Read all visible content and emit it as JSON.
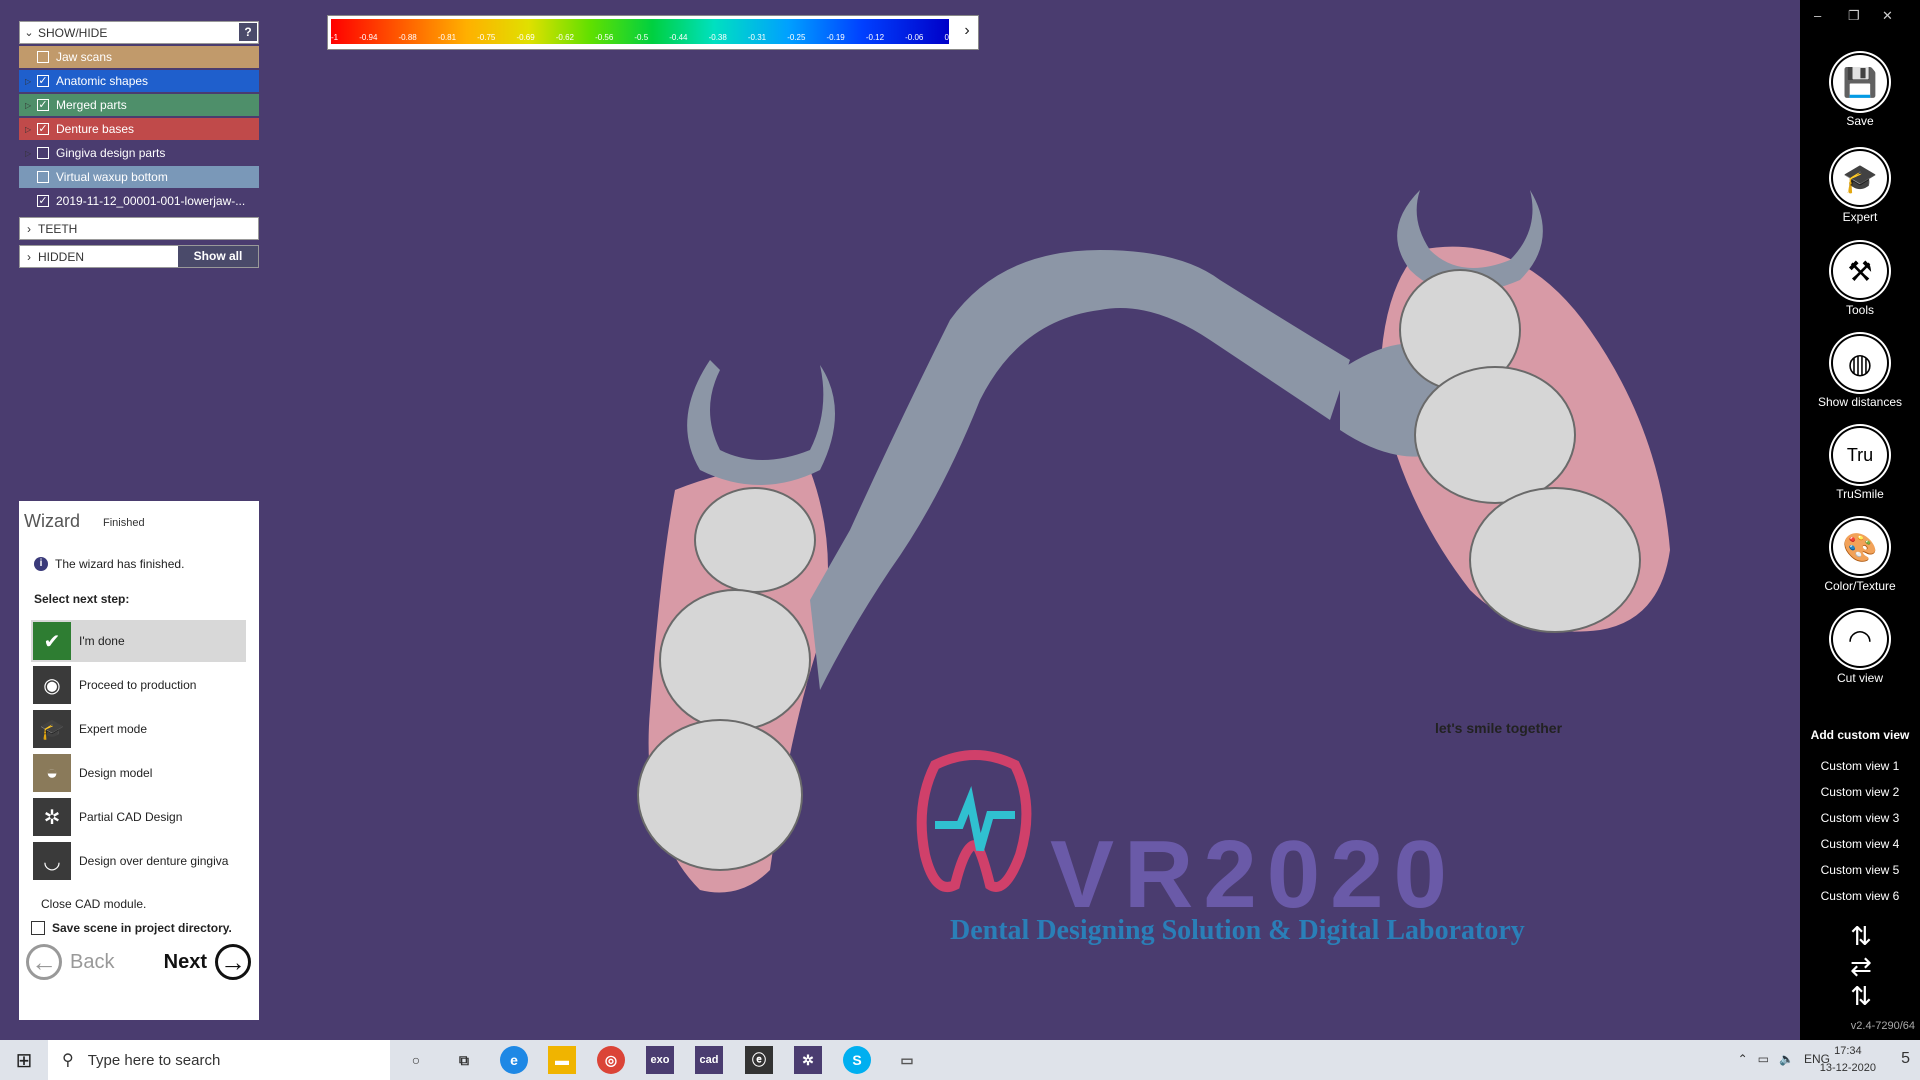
{
  "show_hide": {
    "title": "SHOW/HIDE",
    "help": "?",
    "layers": [
      {
        "label": "Jaw scans",
        "checked": false,
        "color": "#c19a6b"
      },
      {
        "label": "Anatomic shapes",
        "checked": true,
        "color": "#1f5fcc"
      },
      {
        "label": "Merged parts",
        "checked": true,
        "color": "#4e8f6a"
      },
      {
        "label": "Denture bases",
        "checked": true,
        "color": "#c04a4a"
      },
      {
        "label": "Gingiva design parts",
        "checked": false,
        "color": "#4a3c6f"
      },
      {
        "label": "Virtual waxup bottom",
        "checked": false,
        "color": "#7a98b8"
      },
      {
        "label": "2019-11-12_00001-001-lowerjaw-...",
        "checked": true,
        "color": "#4a3c6f"
      }
    ],
    "teeth": "TEETH",
    "hidden": "HIDDEN",
    "show_all": "Show all"
  },
  "color_scale": {
    "labels": [
      "-1",
      "-0.94",
      "-0.88",
      "-0.81",
      "-0.75",
      "-0.69",
      "-0.62",
      "-0.56",
      "-0.5",
      "-0.44",
      "-0.38",
      "-0.31",
      "-0.25",
      "-0.19",
      "-0.12",
      "-0.06",
      "0"
    ],
    "arrow": "›"
  },
  "wizard": {
    "title": "Wizard",
    "status": "Finished",
    "info": "The wizard has finished.",
    "select_label": "Select next step:",
    "steps": [
      {
        "label": "I'm done",
        "icon": "check-icon"
      },
      {
        "label": "Proceed to production",
        "icon": "mill-icon"
      },
      {
        "label": "Expert mode",
        "icon": "graduation-cap-icon"
      },
      {
        "label": "Design model",
        "icon": "model-icon"
      },
      {
        "label": "Partial CAD Design",
        "icon": "partial-icon"
      },
      {
        "label": "Design over denture gingiva",
        "icon": "gingiva-icon"
      }
    ],
    "close_cad": "Close CAD module.",
    "save_scene": "Save scene in project directory.",
    "back": "Back",
    "next": "Next"
  },
  "right_panel": {
    "tools": [
      {
        "label": "Save",
        "icon": "save-icon"
      },
      {
        "label": "Expert",
        "icon": "graduation-cap-icon"
      },
      {
        "label": "Tools",
        "icon": "tools-icon"
      },
      {
        "label": "Show distances",
        "icon": "distances-icon"
      },
      {
        "label": "TruSmile",
        "icon": "trusmile-icon"
      },
      {
        "label": "Color/Texture",
        "icon": "palette-icon"
      },
      {
        "label": "Cut view",
        "icon": "cut-view-icon"
      }
    ],
    "add_custom_view": "Add custom view",
    "custom_views": [
      "Custom view 1",
      "Custom view 2",
      "Custom view 3",
      "Custom view 4",
      "Custom view 5",
      "Custom view 6"
    ],
    "version": "v2.4-7290/64"
  },
  "watermark": {
    "tagline_top": "let's smile together",
    "brand": "VR2020",
    "tagline": "Dental Designing Solution  & Digital Laboratory"
  },
  "taskbar": {
    "search_placeholder": "Type here to search",
    "apps": [
      "exo",
      "cad"
    ],
    "lang": "ENG",
    "time": "17:34",
    "date": "13-12-2020",
    "notifications": "5"
  }
}
